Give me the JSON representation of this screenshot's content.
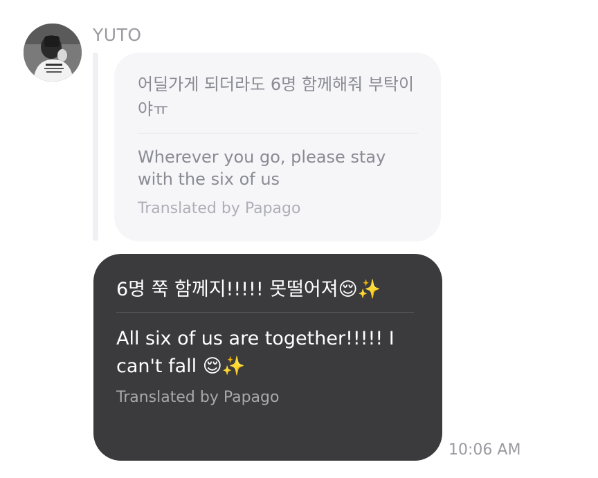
{
  "contact": {
    "name": "YUTO",
    "avatar_icon": "profile-photo"
  },
  "received_message": {
    "original_text": "어딜가게 되더라도 6명 함께해줘 부탁이야ㅠ",
    "translated_text": "Wherever you go, please stay with the six of us",
    "credit": "Translated by Papago"
  },
  "sent_message": {
    "original_text": "6명 쭉 함께지!!!!! 못떨어져😌✨",
    "translated_text": "All six of us are together!!!!! I can't fall 😌✨",
    "credit": "Translated by Papago",
    "timestamp": "10:06 AM"
  },
  "colors": {
    "received_bubble": "#f6f6f9",
    "sent_bubble": "#3b3b3d",
    "secondary_text": "#9a9aa0"
  }
}
